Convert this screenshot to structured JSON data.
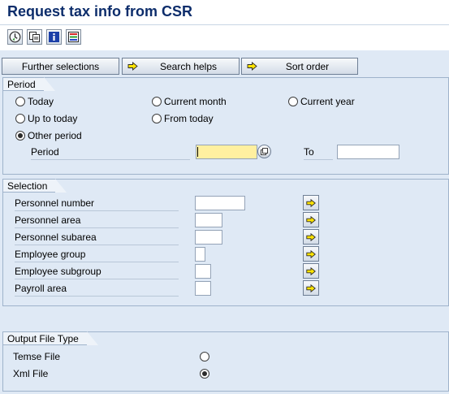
{
  "window": {
    "title": "Request tax info from CSR"
  },
  "toolbar": {
    "buttons": [
      {
        "name": "execute-button",
        "icon": "execute-clock-icon"
      },
      {
        "name": "get-variant-button",
        "icon": "variant-pages-icon"
      },
      {
        "name": "info-button",
        "icon": "info-icon"
      },
      {
        "name": "layout-button",
        "icon": "layout-colors-icon"
      }
    ]
  },
  "selection_buttons": {
    "further_selections": "Further selections",
    "search_helps": "Search helps",
    "sort_order": "Sort order"
  },
  "period": {
    "title": "Period",
    "options": {
      "today": "Today",
      "current_month": "Current month",
      "current_year": "Current year",
      "up_to_today": "Up to today",
      "from_today": "From today",
      "other_period": "Other period"
    },
    "selected": "other_period",
    "period_label": "Period",
    "period_from_value": "",
    "to_label": "To",
    "period_to_value": ""
  },
  "selection": {
    "title": "Selection",
    "fields": [
      {
        "label": "Personnel number",
        "value": ""
      },
      {
        "label": "Personnel area",
        "value": ""
      },
      {
        "label": "Personnel subarea",
        "value": ""
      },
      {
        "label": "Employee group",
        "value": ""
      },
      {
        "label": "Employee subgroup",
        "value": ""
      },
      {
        "label": "Payroll area",
        "value": ""
      }
    ]
  },
  "output": {
    "title": "Output File Type",
    "temse_label": "Temse File",
    "xml_label": "Xml File",
    "selected": "xml"
  },
  "colors": {
    "title": "#0d2d6b",
    "background": "#dfe9f5",
    "required_field": "#fff0a0",
    "arrow_yellow": "#ffe400"
  }
}
